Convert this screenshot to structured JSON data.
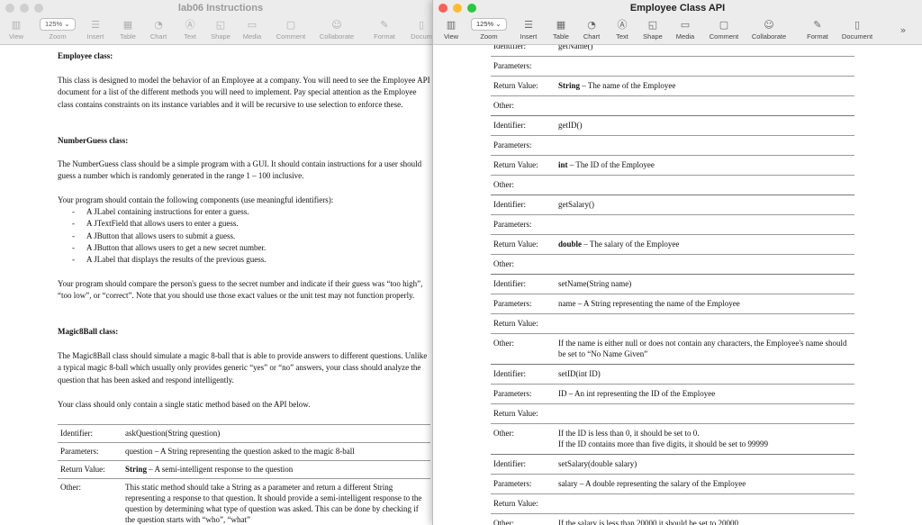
{
  "left_window": {
    "title": "lab06 Instructions",
    "toolbar": [
      {
        "label": "View",
        "icon": "sidebar-icon"
      },
      {
        "label": "Zoom",
        "icon": "zoom-icon",
        "value": "125%"
      },
      {
        "label": "Insert",
        "icon": "insert-icon"
      },
      {
        "label": "Table",
        "icon": "table-icon"
      },
      {
        "label": "Chart",
        "icon": "chart-icon"
      },
      {
        "label": "Text",
        "icon": "text-icon"
      },
      {
        "label": "Shape",
        "icon": "shape-icon"
      },
      {
        "label": "Media",
        "icon": "media-icon"
      },
      {
        "label": "Comment",
        "icon": "comment-icon"
      },
      {
        "label": "Collaborate",
        "icon": "collaborate-icon"
      },
      {
        "label": "Format",
        "icon": "format-icon"
      },
      {
        "label": "Docum",
        "icon": "document-icon"
      }
    ],
    "employee": {
      "heading": "Employee class:",
      "body": "This class is designed to model the behavior of an Employee at a company. You will need to see the Employee API document for a list of the different methods you will need to implement. Pay special attention as the Employee class contains constraints on its instance variables and it will be recursive to use selection to enforce these."
    },
    "numberguess": {
      "heading": "NumberGuess class:",
      "intro": "The NumberGuess class should be a simple program with a GUI. It should contain instructions for a user should guess a number which is randomly generated in the range 1 – 100 inclusive.",
      "components_intro": "Your program should contain the following components (use meaningful identifiers):",
      "components": [
        "A JLabel containing instructions for enter a guess.",
        "A JTextField that allows users to enter a guess.",
        "A JButton that allows users to submit a guess.",
        "A JButton that allows users to get a new secret number.",
        "A JLabel that displays the results of the previous guess."
      ],
      "compare": "Your program should compare the person's guess to the secret number and indicate if their guess was “too high”, “too low”, or “correct”. Note that you should use those exact values or the unit test may not function properly."
    },
    "magic": {
      "heading": "Magic8Ball class:",
      "body": "The Magic8Ball class should simulate a magic 8-ball that is able to provide answers to different questions. Unlike a typical magic 8-ball which usually only provides generic “yes” or “no” answers, your class should analyze the question that has been asked and respond intelligently.",
      "static_note": "Your class should only contain a single static method based on the API below."
    },
    "table": [
      {
        "key": "Identifier:",
        "value": "askQuestion(String question)"
      },
      {
        "key": "Parameters:",
        "value": "question – A String representing the question asked to the magic 8-ball"
      },
      {
        "key": "Return Value:",
        "value_bold": "String",
        "value": " – A semi-intelligent response to the question"
      },
      {
        "key": "Other:",
        "value": "This static method should take a String as a parameter and return a different String representing a response to that question. It should provide a semi-intelligent response to the question by determining what type of question was asked. This can be done by checking if the question starts with “who”, “what”"
      }
    ]
  },
  "right_window": {
    "title": "Employee Class API",
    "toolbar": [
      {
        "label": "View",
        "icon": "sidebar-icon"
      },
      {
        "label": "Zoom",
        "icon": "zoom-icon",
        "value": "125%"
      },
      {
        "label": "Insert",
        "icon": "insert-icon"
      },
      {
        "label": "Table",
        "icon": "table-icon"
      },
      {
        "label": "Chart",
        "icon": "chart-icon"
      },
      {
        "label": "Text",
        "icon": "text-icon"
      },
      {
        "label": "Shape",
        "icon": "shape-icon"
      },
      {
        "label": "Media",
        "icon": "media-icon"
      },
      {
        "label": "Comment",
        "icon": "comment-icon"
      },
      {
        "label": "Collaborate",
        "icon": "collaborate-icon"
      },
      {
        "label": "Format",
        "icon": "format-icon"
      },
      {
        "label": "Document",
        "icon": "document-icon"
      }
    ],
    "overflow": "»",
    "rows": [
      {
        "key": "Identifier:",
        "value": "getName()",
        "sep": false
      },
      {
        "key": "Parameters:",
        "value": "",
        "sep": false
      },
      {
        "key": "Return Value:",
        "value_bold": "String",
        "value": " – The name of the Employee",
        "sep": false
      },
      {
        "key": "Other:",
        "value": "",
        "sep": false
      },
      {
        "key": "Identifier:",
        "value": "getID()",
        "sep": true
      },
      {
        "key": "Parameters:",
        "value": "",
        "sep": false
      },
      {
        "key": "Return Value:",
        "value_bold": "int",
        "value": " – The ID of the Employee",
        "sep": false
      },
      {
        "key": "Other:",
        "value": "",
        "sep": false
      },
      {
        "key": "Identifier:",
        "value": "getSalary()",
        "sep": true
      },
      {
        "key": "Parameters:",
        "value": "",
        "sep": false
      },
      {
        "key": "Return Value:",
        "value_bold": "double",
        "value": " – The salary of the Employee",
        "sep": false
      },
      {
        "key": "Other:",
        "value": "",
        "sep": false
      },
      {
        "key": "Identifier:",
        "value": "setName(String name)",
        "sep": true
      },
      {
        "key": "Parameters:",
        "value": "name – A String representing the name of the Employee",
        "sep": false
      },
      {
        "key": "Return Value:",
        "value": "",
        "sep": false
      },
      {
        "key": "Other:",
        "value": "If the name is either null or does not contain any characters, the Employee's name should be set to “No Name Given”",
        "sep": false
      },
      {
        "key": "Identifier:",
        "value": "setID(int ID)",
        "sep": true
      },
      {
        "key": "Parameters:",
        "value": "ID – An int representing the ID of the Employee",
        "sep": false
      },
      {
        "key": "Return Value:",
        "value": "",
        "sep": false
      },
      {
        "key": "Other:",
        "value": "If the ID is less than 0, it should be set to 0.",
        "value2": "If the ID contains more than five digits, it should be set to 99999",
        "sep": false
      },
      {
        "key": "Identifier:",
        "value": "setSalary(double salary)",
        "sep": true
      },
      {
        "key": "Parameters:",
        "value": "salary – A double representing the salary of the Employee",
        "sep": false
      },
      {
        "key": "Return Value:",
        "value": "",
        "sep": false
      },
      {
        "key": "Other:",
        "value": "If the salary is less than 20000 it should be set to 20000",
        "sep": false
      }
    ]
  }
}
